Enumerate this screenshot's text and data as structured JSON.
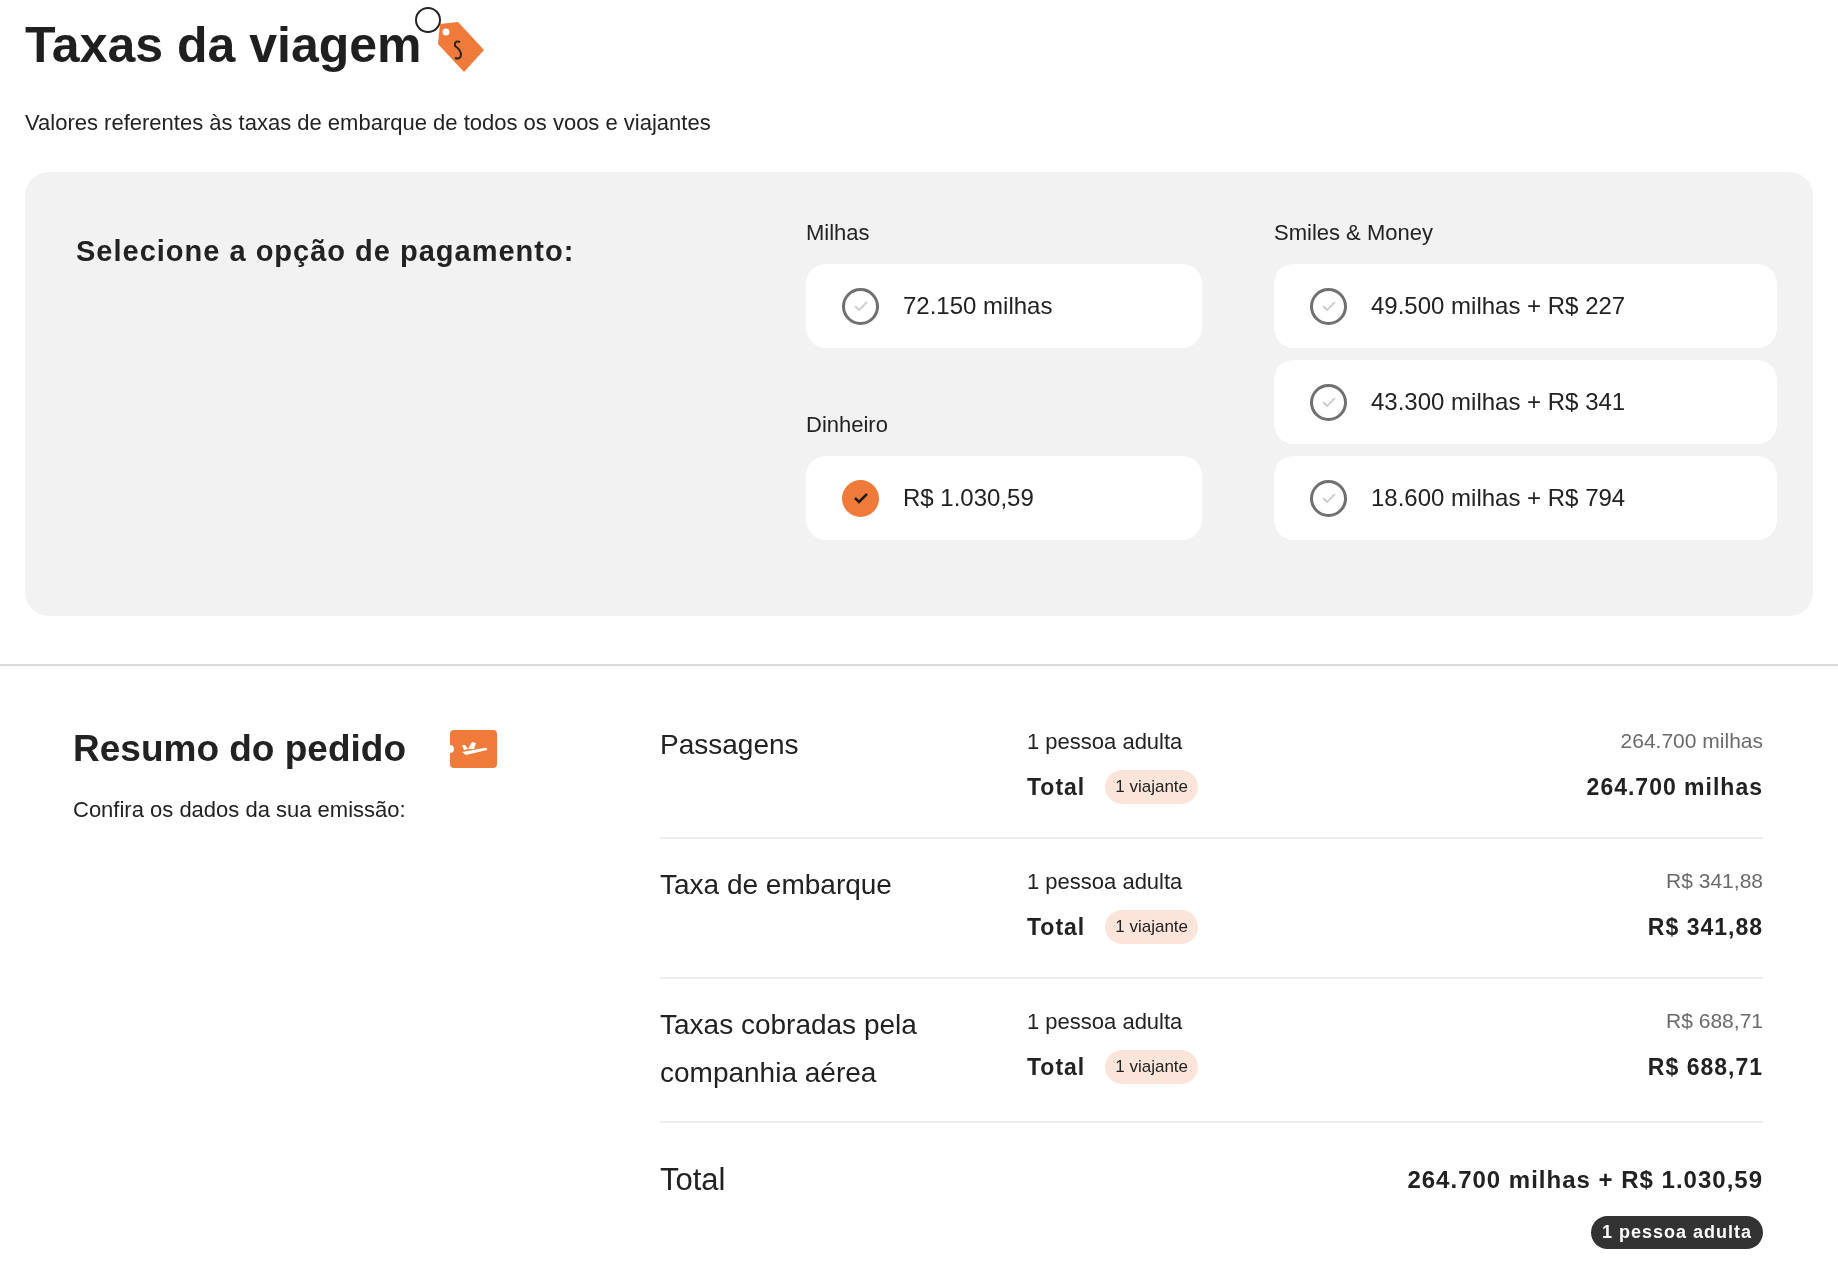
{
  "header": {
    "title": "Taxas da viagem",
    "subtitle": "Valores referentes às taxas de embarque de todos os voos e viajantes"
  },
  "payment": {
    "prompt": "Selecione a opção de pagamento:",
    "columns": [
      {
        "groups": [
          {
            "label": "Milhas",
            "options": [
              {
                "label": "72.150 milhas",
                "selected": false
              }
            ]
          },
          {
            "label": "Dinheiro",
            "options": [
              {
                "label": "R$ 1.030,59",
                "selected": true
              }
            ]
          }
        ]
      },
      {
        "groups": [
          {
            "label": "Smiles & Money",
            "options": [
              {
                "label": "49.500 milhas + R$ 227",
                "selected": false
              },
              {
                "label": "43.300 milhas + R$ 341",
                "selected": false
              },
              {
                "label": "18.600 milhas + R$ 794",
                "selected": false
              }
            ]
          }
        ]
      }
    ]
  },
  "summary": {
    "title": "Resumo do pedido",
    "subtitle": "Confira os dados da sua emissão:",
    "items": [
      {
        "name": "Passagens",
        "travelers": "1 pessoa adulta",
        "price": "264.700 milhas",
        "total_label": "Total",
        "badge": "1 viajante",
        "total": "264.700 milhas"
      },
      {
        "name": "Taxa de embarque",
        "travelers": "1 pessoa adulta",
        "price": "R$ 341,88",
        "total_label": "Total",
        "badge": "1 viajante",
        "total": "R$ 341,88"
      },
      {
        "name": "Taxas cobradas pela companhia aérea",
        "travelers": "1 pessoa adulta",
        "price": "R$ 688,71",
        "total_label": "Total",
        "badge": "1 viajante",
        "total": "R$ 688,71"
      }
    ],
    "total": {
      "label": "Total",
      "value": "264.700 milhas + R$ 1.030,59",
      "badge": "1 pessoa adulta"
    }
  }
}
